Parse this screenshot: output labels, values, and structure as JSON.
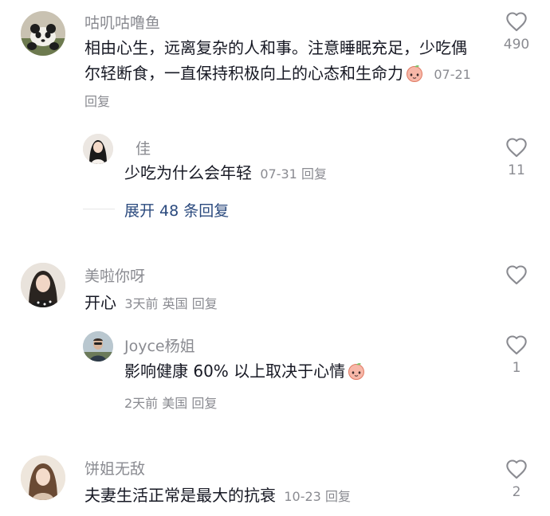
{
  "comments": [
    {
      "username": "咕叽咕噜鱼",
      "text": "相由心生，远离复杂的人和事。注意睡眠充足，少吃偶尔轻断食，一直保持积极向上的心态和生命力",
      "emoji": "peach-emoji",
      "date": "07-21",
      "reply_label": "回复",
      "likes": "490",
      "avatar_icon": "panda-avatar",
      "reply": {
        "username": "佳",
        "text": "少吃为什么会年轻",
        "date": "07-31",
        "reply_label": "回复",
        "likes": "11",
        "avatar_icon": "woman-avatar"
      },
      "expand_label": "展开 48 条回复"
    },
    {
      "username": "美啦你呀",
      "text": "开心",
      "date": "3天前",
      "location": "英国",
      "reply_label": "回复",
      "likes": "",
      "avatar_icon": "woman-avatar",
      "reply": {
        "username": "Joyce杨姐",
        "text": "影响健康 60% 以上取决于心情",
        "emoji": "peach-emoji",
        "date": "2天前",
        "location": "美国",
        "reply_label": "回复",
        "likes": "1",
        "avatar_icon": "man-avatar"
      }
    },
    {
      "username": "饼姐无敌",
      "text": "夫妻生活正常是最大的抗衰",
      "date": "10-23",
      "reply_label": "回复",
      "likes": "2",
      "avatar_icon": "woman-avatar"
    }
  ],
  "colors": {
    "text": "#161823",
    "secondary": "#8a8b91",
    "link": "#2b4a7e",
    "icon": "#8a8b91"
  }
}
